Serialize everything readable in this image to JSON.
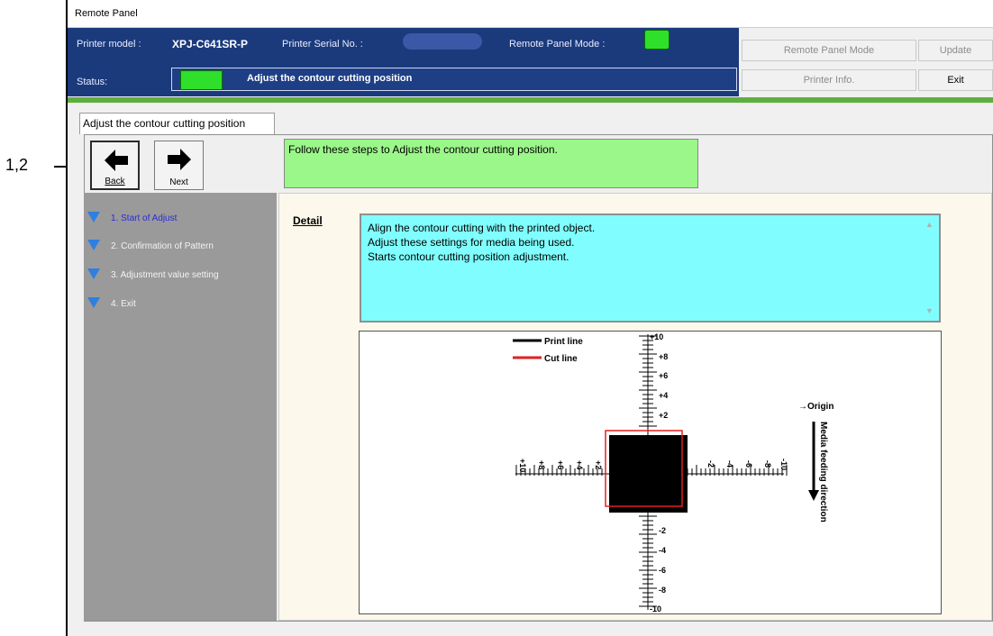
{
  "callout": {
    "label": "1,2"
  },
  "window": {
    "title": "Remote Panel"
  },
  "header": {
    "printer_model_label": "Printer model :",
    "printer_model_value": "XPJ-C641SR-P",
    "serial_label": "Printer Serial No. :",
    "remote_mode_label": "Remote Panel Mode :",
    "status_label": "Status:",
    "status_text": "Adjust the contour cutting position",
    "led_color": "#2fe02a"
  },
  "buttons": {
    "remote_panel_mode": "Remote Panel Mode",
    "update": "Update",
    "printer_info": "Printer Info.",
    "exit": "Exit"
  },
  "tab": {
    "label": "Adjust the contour cutting position"
  },
  "nav": {
    "back_label": "Back",
    "next_label": "Next"
  },
  "message": "Follow these steps to Adjust the contour cutting position.",
  "steps": [
    {
      "label": "1. Start of Adjust",
      "active": true
    },
    {
      "label": "2. Confirmation of Pattern",
      "active": false
    },
    {
      "label": "3. Adjustment value setting",
      "active": false
    },
    {
      "label": "4. Exit",
      "active": false
    }
  ],
  "detail": {
    "label": "Detail",
    "lines": [
      "Align the contour cutting with the printed object.",
      "Adjust these settings for media being used.",
      "Starts contour cutting position adjustment."
    ]
  },
  "diagram": {
    "legend_print": "Print line",
    "legend_cut": "Cut line",
    "origin_label": "→Origin",
    "feed_label": "Media feeding direction",
    "v_ticks_top": [
      "+10",
      "+8",
      "+6",
      "+4",
      "+2"
    ],
    "v_ticks_bottom": [
      "-2",
      "-4",
      "-6",
      "-8",
      "-10"
    ],
    "h_ticks_left": [
      "+10",
      "+8",
      "+6",
      "+4",
      "+2"
    ],
    "h_ticks_right": [
      "-2",
      "-4",
      "-6",
      "-8",
      "-10"
    ],
    "print_color": "#000000",
    "cut_color": "#e02020"
  },
  "colors": {
    "accent_blue": "#1b3a7c",
    "green_stripe": "#5dae3e",
    "message_bg": "#9cf78a",
    "detail_bg": "#80feff"
  }
}
